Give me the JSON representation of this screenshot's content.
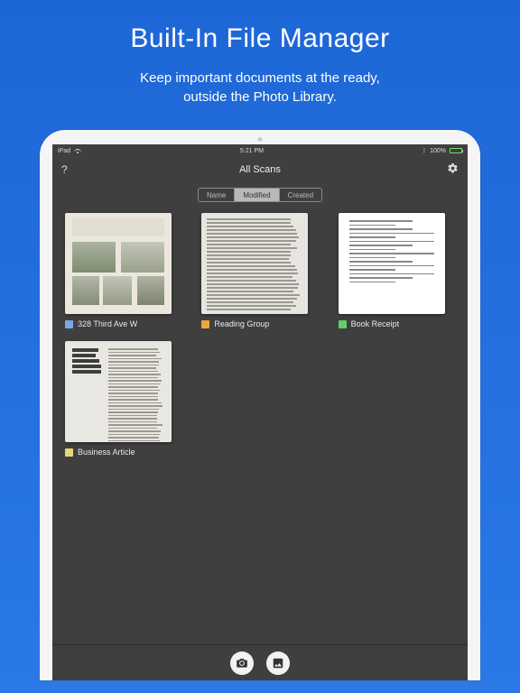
{
  "marketing": {
    "headline": "Built-In File Manager",
    "subhead_line1": "Keep important documents at the ready,",
    "subhead_line2": "outside the Photo Library."
  },
  "status": {
    "device": "iPad",
    "time": "5:21 PM",
    "battery_pct": "100%"
  },
  "navbar": {
    "help_label": "?",
    "title": "All Scans"
  },
  "sort": {
    "options": [
      "Name",
      "Modified",
      "Created"
    ],
    "active_index": 1
  },
  "colors": {
    "blue": "#7aa8e6",
    "orange": "#f0a63c",
    "green": "#5fd06a",
    "yellow": "#e6d877"
  },
  "scans": [
    {
      "label": "328 Third Ave W",
      "swatch": "blue",
      "kind": "flyer"
    },
    {
      "label": "Reading Group",
      "swatch": "orange",
      "kind": "textpage"
    },
    {
      "label": "Book Receipt",
      "swatch": "green",
      "kind": "receipt"
    },
    {
      "label": "Business Article",
      "swatch": "yellow",
      "kind": "article"
    }
  ]
}
